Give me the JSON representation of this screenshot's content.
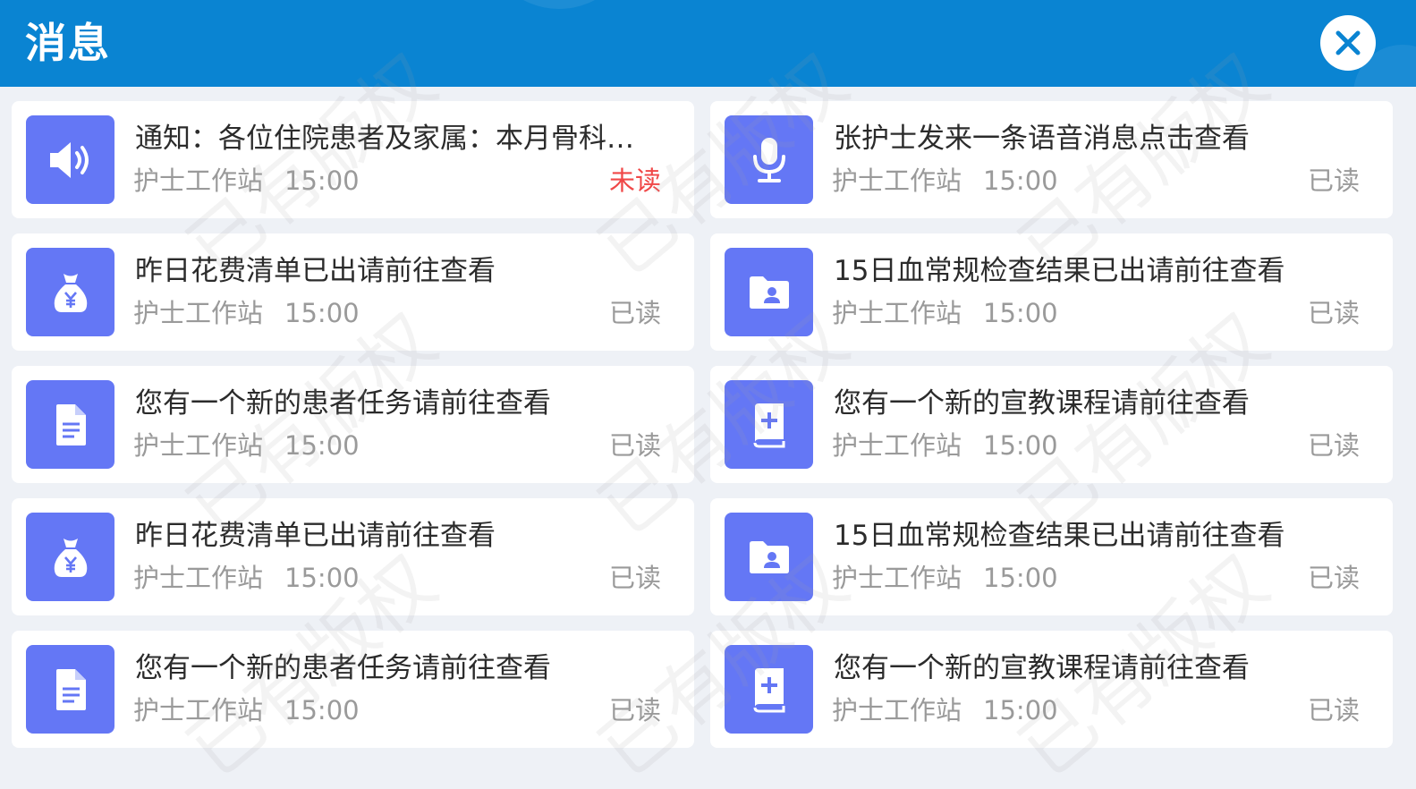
{
  "header": {
    "title": "消息",
    "close_icon": "close-icon"
  },
  "colors": {
    "header_bg": "#0a84d2",
    "icon_bg": "#6477f5",
    "unread": "#f04848",
    "read": "#9a9a9a"
  },
  "messages": [
    {
      "icon": "speaker-icon",
      "title": "通知：各位住院患者及家属：本月骨科…",
      "source": "护士工作站",
      "time": "15:00",
      "status": "未读",
      "unread": true
    },
    {
      "icon": "microphone-icon",
      "title": "张护士发来一条语音消息点击查看",
      "source": "护士工作站",
      "time": "15:00",
      "status": "已读",
      "unread": false
    },
    {
      "icon": "money-bag-icon",
      "title": "昨日花费清单已出请前往查看",
      "source": "护士工作站",
      "time": "15:00",
      "status": "已读",
      "unread": false
    },
    {
      "icon": "patient-folder-icon",
      "title": "15日血常规检查结果已出请前往查看",
      "source": "护士工作站",
      "time": "15:00",
      "status": "已读",
      "unread": false
    },
    {
      "icon": "document-icon",
      "title": "您有一个新的患者任务请前往查看",
      "source": "护士工作站",
      "time": "15:00",
      "status": "已读",
      "unread": false
    },
    {
      "icon": "medical-book-icon",
      "title": "您有一个新的宣教课程请前往查看",
      "source": "护士工作站",
      "time": "15:00",
      "status": "已读",
      "unread": false
    },
    {
      "icon": "money-bag-icon",
      "title": "昨日花费清单已出请前往查看",
      "source": "护士工作站",
      "time": "15:00",
      "status": "已读",
      "unread": false
    },
    {
      "icon": "patient-folder-icon",
      "title": "15日血常规检查结果已出请前往查看",
      "source": "护士工作站",
      "time": "15:00",
      "status": "已读",
      "unread": false
    },
    {
      "icon": "document-icon",
      "title": "您有一个新的患者任务请前往查看",
      "source": "护士工作站",
      "time": "15:00",
      "status": "已读",
      "unread": false
    },
    {
      "icon": "medical-book-icon",
      "title": "您有一个新的宣教课程请前往查看",
      "source": "护士工作站",
      "time": "15:00",
      "status": "已读",
      "unread": false
    }
  ],
  "watermark": "已有版权"
}
